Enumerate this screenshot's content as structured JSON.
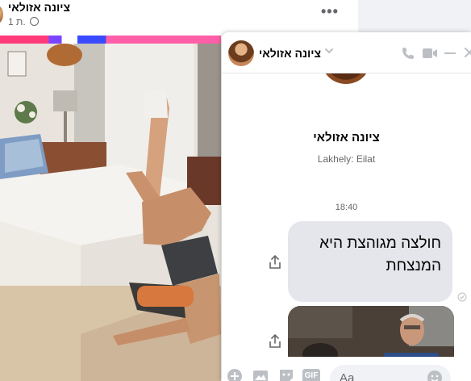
{
  "post": {
    "author": "ציונה אזולאי",
    "time": "1 ת.",
    "more_label": "•••"
  },
  "chat": {
    "name": "ציונה אזולאי",
    "profile_name": "ציונה אזולאי",
    "location": "Lakhely: Eilat",
    "timestamp": "18:40",
    "message": "חולצה מגוהצת היא המנצחת",
    "input_placeholder": "Aa",
    "gif_label": "GIF"
  },
  "colors": {
    "accent": "#bcc0c4",
    "bubble": "#e4e6eb",
    "text": "#050505",
    "muted": "#65676b"
  },
  "icons": [
    "chevron-down-icon",
    "phone-icon",
    "video-call-icon",
    "minimize-icon",
    "close-icon",
    "share-icon",
    "seen-check-icon",
    "plus-icon",
    "image-icon",
    "sticker-icon",
    "gif-icon",
    "emoji-icon",
    "globe-icon"
  ]
}
